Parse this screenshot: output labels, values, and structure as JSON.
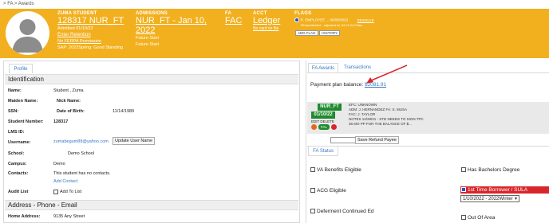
{
  "breadcrumb": {
    "sep": ">",
    "item1": "FA",
    "item2": "Awards"
  },
  "header": {
    "student": {
      "label": "ZUMA STUDENT",
      "id": "128317 NUR_FT",
      "admitted": "Admitted 01/10/22",
      "enter_retention": "Enter Retention",
      "ferpa": "No FERPA Permission",
      "sap": "SAP: 2022Spring: Good Standing"
    },
    "admissions": {
      "label": "ADMISSIONS",
      "program": "NUR_FT - Jan 10, 2022",
      "line1": "Future Start",
      "line2": "Future Start"
    },
    "fa": {
      "label": "FA",
      "link": "FAC"
    },
    "acct": {
      "label": "ACCT",
      "link": "Ledger",
      "sub": "No card on file"
    },
    "flags": {
      "label": "FLAGS",
      "text": "R. EMPLOYEE ... 06/08/2023",
      "sub": "Pinned/Added - adjusted for 04.23.24 Falso",
      "resolve": "RESOLVE",
      "add_btn": "ADD FLAG",
      "history_btn": "HISTORY"
    }
  },
  "profile_tab": "Profile",
  "identification": {
    "heading": "Identification",
    "name_label": "Name:",
    "name_value": "Student , Zuma",
    "maiden_label": "Maiden Name:",
    "nick_label": "Nick Name:",
    "ssn_label": "SSN:",
    "dob_label": "Date of Birth:",
    "dob_value": "11/14/1989",
    "student_number_label": "Student Number:",
    "student_number_value": "128317",
    "lms_label": "LMS ID:",
    "username_label": "Username:",
    "username_value": "zumabegum88@yahoo.com",
    "update_user_btn": "Update User Name",
    "school_label": "School:",
    "school_value": "Demo School",
    "campus_label": "Campus:",
    "campus_value": "Demo",
    "contacts_label": "Contacts:",
    "contacts_value": "This student has no contacts.",
    "add_contact": "Add Contact",
    "audit_label": "Audit List",
    "add_to_list": "Add To List"
  },
  "address": {
    "heading": "Address - Phone - Email",
    "home_label": "Home Address:",
    "home_value": "9135 Any Street"
  },
  "right": {
    "tab_awards": "FA Awards",
    "tab_transactions": "Transactions",
    "payment_label": "Payment plan balance:",
    "payment_value": "$2081.91",
    "program_badge": "NUR_FT",
    "date_badge": "01/10/22",
    "edit_delete": "EDIT DELETE",
    "fal_badge": "FAL",
    "efc": "EFC: UNKNOWN",
    "adm": "ADM: J. HERNANDEZ  FA: S. MUSA",
    "fac": "FAC: J. TAYLOR",
    "notes": "NOTES 12/28/21 - STD NEEDS TO SIGN TPC",
    "notes2": "36 MO PP FOR THE BALANCE OF $...",
    "save_refund_btn": "Save Refund Payee",
    "fa_status_tab": "FA Status",
    "va_benefits": "VA Benefits Eligible",
    "bachelors": "Has Bachelors Degree",
    "acg": "ACG Eligible",
    "first_time": "1st Time Borrower / SULA",
    "term_select": "1/10/2022 - 2022Winter",
    "deferment": "Deferment Continued Ed",
    "out_of_area": "Out Of Area"
  },
  "colors": {
    "header_bg": "#f2b01e",
    "link": "#3478c6",
    "badge_green": "#1e8a2e",
    "arrow_red": "#d9262b",
    "flag_red": "#d9262b"
  }
}
